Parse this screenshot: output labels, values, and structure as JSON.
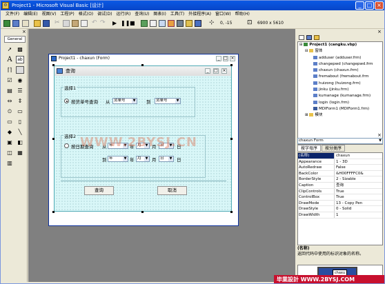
{
  "window": {
    "title": "Project1 - Microsoft Visual Basic [设计]",
    "btn_min": "_",
    "btn_max": "□",
    "btn_close": "×"
  },
  "menu": [
    "文件(F)",
    "编辑(E)",
    "视图(V)",
    "工程(P)",
    "格式(O)",
    "调试(D)",
    "运行(R)",
    "查询(U)",
    "图表(I)",
    "工具(T)",
    "外接程序(A)",
    "窗口(W)",
    "帮助(H)"
  ],
  "toolbar": {
    "position_readout": "0, -15",
    "size_readout": "6900 x 5610"
  },
  "toolbox": {
    "tab_label": "General",
    "close": "×"
  },
  "form_window": {
    "title": "Project1 - chaxun (Form)",
    "btn_min": "_",
    "btn_max": "□",
    "btn_close": "×"
  },
  "query_form": {
    "title": "查询",
    "btn_min": "_",
    "btn_max": "□",
    "btn_close": "×",
    "group1": {
      "label": "选择1",
      "radio_label": "按货单号查询",
      "from_label": "从",
      "from_value": "货单号",
      "to_label": "到",
      "to_value": "货单号"
    },
    "group2": {
      "label": "选择2",
      "radio_label": "按日期查询",
      "from_label": "从",
      "to_label": "到",
      "year_combo": "年",
      "month_combo": "月",
      "day_combo": "日",
      "year_unit": "年",
      "month_unit": "月",
      "day_unit": "日"
    },
    "query_button": "查询",
    "cancel_button": "取消"
  },
  "watermark": "WWW.2BYSJ.CN",
  "project_explorer": {
    "root": "Project1 (cangku.vbp)",
    "forms_folder": "窗体",
    "forms": [
      "adduser (adduser.frm)",
      "changepwd (changepwd.frm",
      "chaxun (chaxun.frm)",
      "fremabout (fremabout.frm",
      "huizong (huizong.frm)",
      "jinku (jinku.frm)",
      "kumanage (kumanage.frm)",
      "login (login.frm)",
      "MDIForm1 (MDIForm1.frm)"
    ],
    "modules_folder": "模块"
  },
  "properties": {
    "object_selector": "chaxun Form",
    "tab_alpha": "按字母序",
    "tab_category": "按分类序",
    "rows": [
      {
        "k": "(名称)",
        "v": "chaxun"
      },
      {
        "k": "Appearance",
        "v": "1 - 3D"
      },
      {
        "k": "AutoRedraw",
        "v": "False"
      },
      {
        "k": "BackColor",
        "v": "&H00FFFFC0&"
      },
      {
        "k": "BorderStyle",
        "v": "2 - Sizable"
      },
      {
        "k": "Caption",
        "v": "查询"
      },
      {
        "k": "ClipControls",
        "v": "True"
      },
      {
        "k": "ControlBox",
        "v": "True"
      },
      {
        "k": "DrawMode",
        "v": "13 - Copy Pen"
      },
      {
        "k": "DrawStyle",
        "v": "0 - Solid"
      },
      {
        "k": "DrawWidth",
        "v": "1"
      }
    ],
    "description_title": "(名称)",
    "description_text": "返回代码中使用的标识对象的名称。"
  },
  "form_layout": {
    "form_label": "chaxu"
  },
  "brand_logo": "毕業設計 WWW.2BYSJ.COM",
  "colors": {
    "title_blue": "#0a58e4",
    "form_back": "#d9f7f8",
    "selected_row": "#0a246a"
  }
}
